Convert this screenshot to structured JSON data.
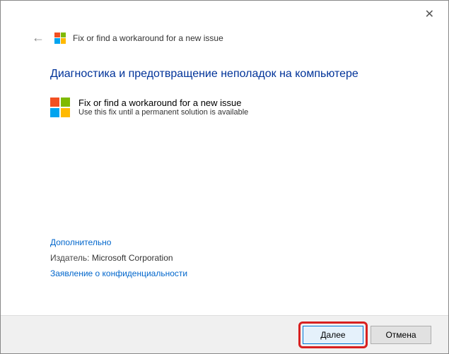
{
  "window": {
    "title": "Fix or find a workaround for a new issue"
  },
  "main": {
    "heading": "Диагностика и предотвращение неполадок на компьютере",
    "fix": {
      "title": "Fix or find a workaround for a new issue",
      "subtitle": "Use this fix until a permanent solution is available"
    }
  },
  "links": {
    "advanced": "Дополнительно",
    "publisher_label": "Издатель:",
    "publisher_value": "Microsoft Corporation",
    "privacy": "Заявление о конфиденциальности"
  },
  "footer": {
    "next": "Далее",
    "cancel": "Отмена"
  }
}
